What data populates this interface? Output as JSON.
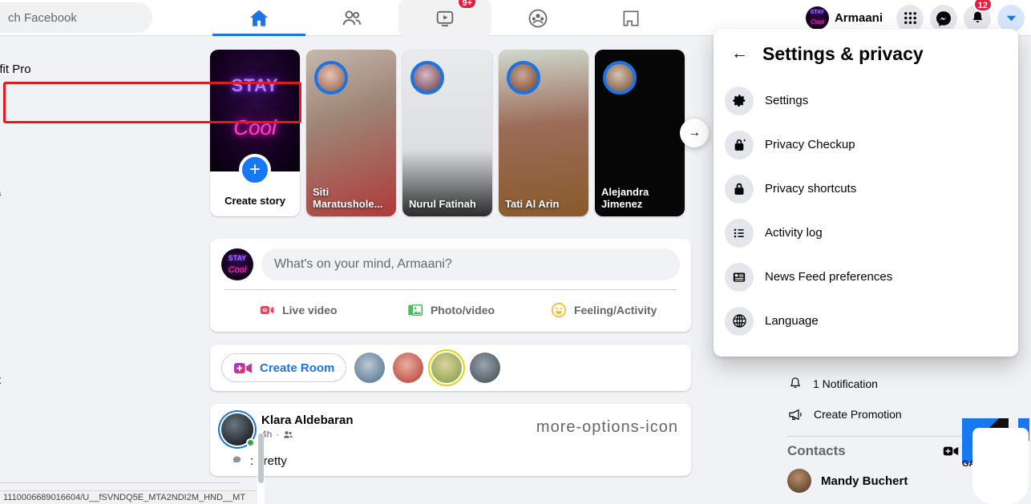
{
  "topnav": {
    "search_text": "ch Facebook",
    "search_placeholder": "Search Facebook",
    "tabs": [
      {
        "name": "home",
        "icon": "home-icon",
        "active": true,
        "badge": ""
      },
      {
        "name": "friends",
        "icon": "friends-icon",
        "active": false,
        "badge": ""
      },
      {
        "name": "watch",
        "icon": "watch-icon",
        "active": false,
        "badge": "9+"
      },
      {
        "name": "groups",
        "icon": "groups-icon",
        "active": false,
        "badge": ""
      },
      {
        "name": "gaming",
        "icon": "gaming-icon",
        "active": false,
        "badge": ""
      }
    ],
    "profile_name": "Armaani",
    "menu_icon": "grid-menu-icon",
    "messenger_icon": "messenger-icon",
    "notifications_icon": "bell-icon",
    "notifications_badge": "12",
    "account_icon": "chevron-down-icon",
    "accent_blue": "#1b74e4"
  },
  "left_rail": {
    "item_1": "olourfit Pro",
    "item_2": "s",
    "item_3": "t"
  },
  "stories": {
    "create_label": "Create story",
    "create_neon_line1": "STAY",
    "create_neon_line2": "Cool",
    "create_plus": "+",
    "next_arrow": "→",
    "items": [
      {
        "name": "Siti Maratushole..."
      },
      {
        "name": "Nurul Fatinah"
      },
      {
        "name": "Tati Al Arin"
      },
      {
        "name": "Alejandra Jimenez"
      }
    ]
  },
  "composer": {
    "placeholder": "What's on your mind, Armaani?",
    "actions": [
      {
        "label": "Live video",
        "icon": "live-video-icon",
        "color": "#f3425f"
      },
      {
        "label": "Photo/video",
        "icon": "photo-video-icon",
        "color": "#45bd62"
      },
      {
        "label": "Feeling/Activity",
        "icon": "feeling-activity-icon",
        "color": "#f7b928"
      }
    ]
  },
  "rooms": {
    "create_room_label": "Create Room",
    "create_room_icon": "video-plus-icon"
  },
  "post": {
    "author": "Klara Aldebaran",
    "time": "4h",
    "audience_icon": "friends-audience-icon",
    "more_icon": "more-options-icon",
    "body": ": pretty"
  },
  "right_rail": {
    "notification_row": "1 Notification",
    "notification_icon": "bell-outline-icon",
    "promotion_row": "Create Promotion",
    "promotion_icon": "megaphone-icon",
    "contacts_title": "Contacts",
    "contacts_video_icon": "video-plus-icon",
    "contacts": [
      {
        "name": "Mandy Buchert"
      }
    ]
  },
  "dropdown": {
    "back_icon": "back-arrow-icon",
    "title": "Settings & privacy",
    "highlight_color": "#e01b1b",
    "items": [
      {
        "label": "Settings",
        "icon": "gear-icon",
        "highlighted": true
      },
      {
        "label": "Privacy Checkup",
        "icon": "lock-check-icon",
        "highlighted": false
      },
      {
        "label": "Privacy shortcuts",
        "icon": "lock-icon",
        "highlighted": false
      },
      {
        "label": "Activity log",
        "icon": "list-icon",
        "highlighted": false
      },
      {
        "label": "News Feed preferences",
        "icon": "news-feed-icon",
        "highlighted": false
      },
      {
        "label": "Language",
        "icon": "globe-icon",
        "highlighted": false
      }
    ]
  },
  "watermark": {
    "text": "GAD"
  },
  "statusbar": {
    "url_text": "1110006689016604/U__fSVNDQ5E_MTA2NDI2M_HND__MT"
  }
}
